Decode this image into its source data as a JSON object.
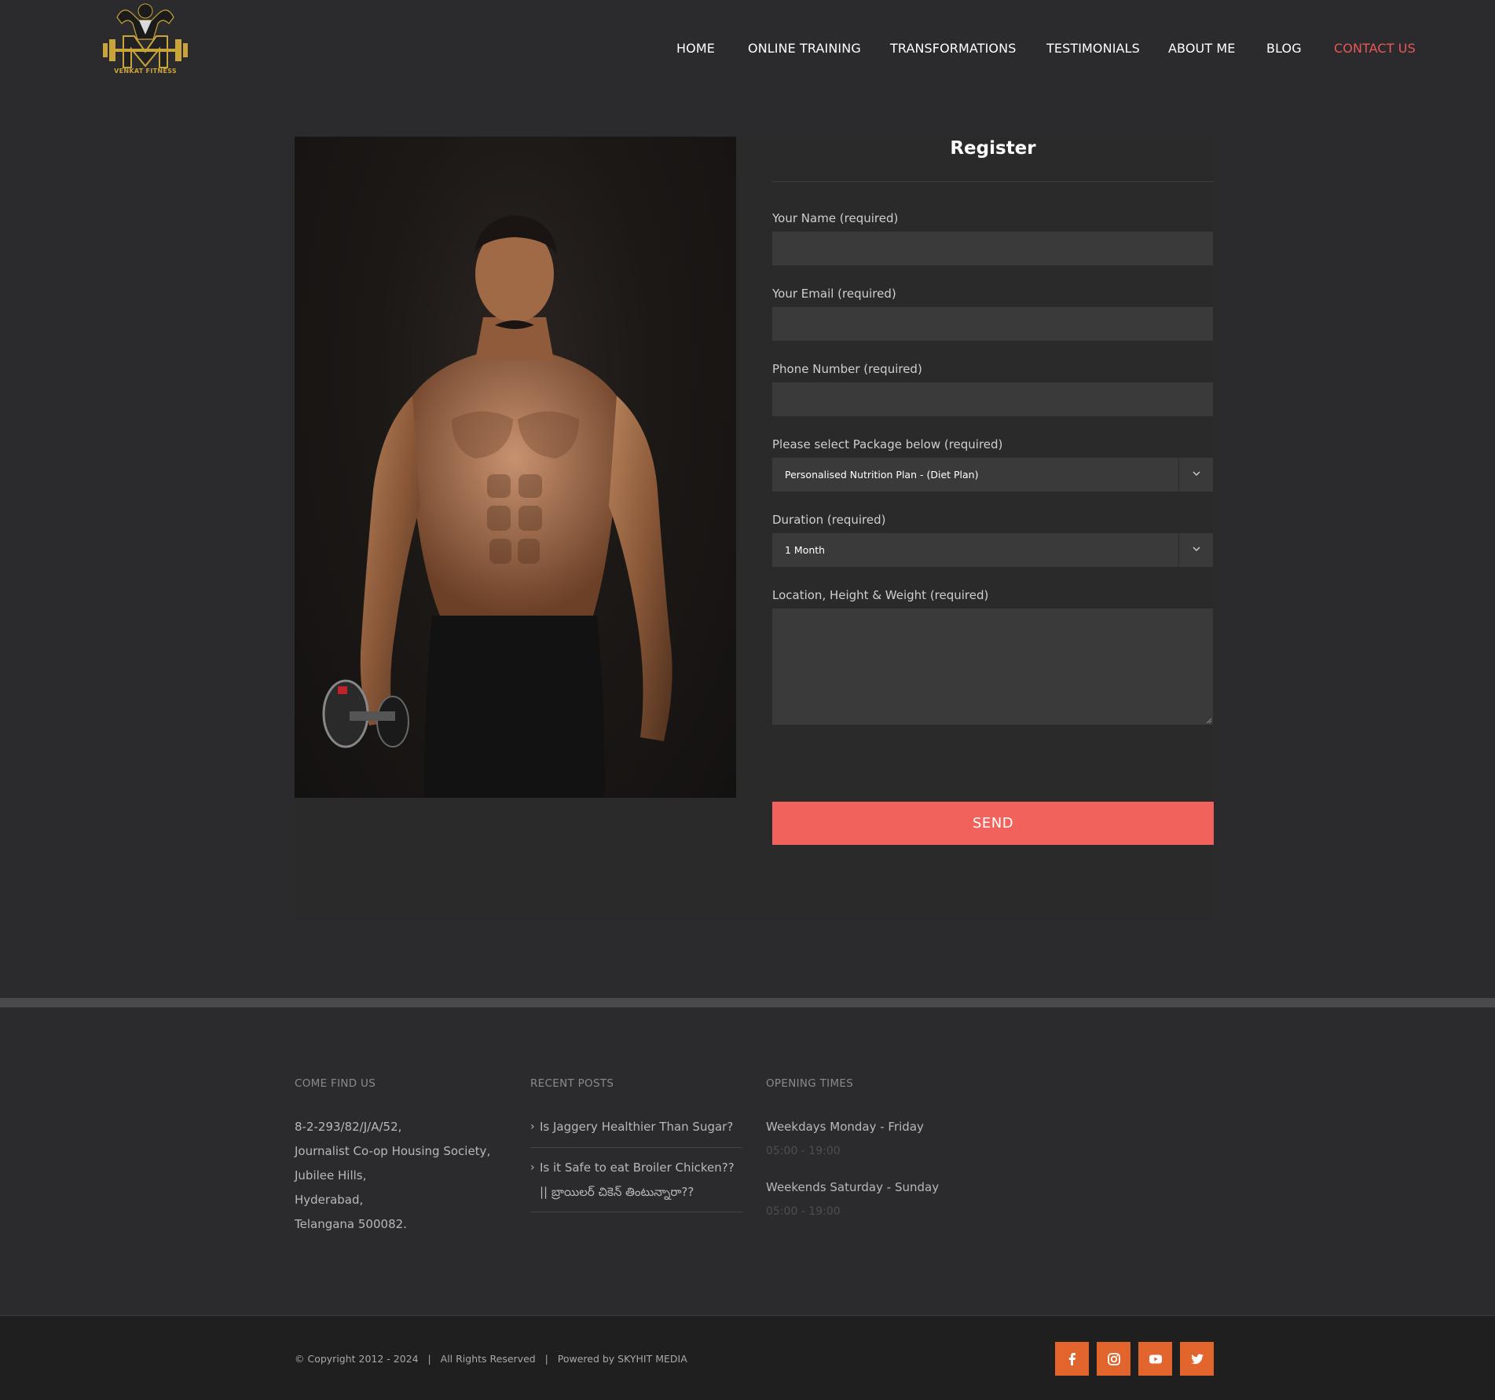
{
  "nav": {
    "items": [
      {
        "label": "HOME"
      },
      {
        "label": "ONLINE TRAINING"
      },
      {
        "label": "TRANSFORMATIONS"
      },
      {
        "label": "TESTIMONIALS"
      },
      {
        "label": "ABOUT ME"
      },
      {
        "label": "BLOG"
      },
      {
        "label": "CONTACT US",
        "active": true
      }
    ]
  },
  "logo": {
    "text": "VENKAT FITNESS"
  },
  "form": {
    "title": "Register",
    "fields": [
      {
        "label": "Your Name (required)",
        "value": ""
      },
      {
        "label": "Your Email (required)",
        "value": ""
      },
      {
        "label": "Phone Number (required)",
        "value": ""
      },
      {
        "label": "Please select Package below (required)",
        "value": "Personalised Nutrition Plan - (Diet Plan)"
      },
      {
        "label": "Duration (required)",
        "value": "1 Month"
      },
      {
        "label": "Location, Height & Weight (required)",
        "value": ""
      }
    ],
    "submit_label": "SEND"
  },
  "footer": {
    "find_us": {
      "title": "COME FIND US",
      "lines": [
        "8-2-293/82/J/A/52,",
        "Journalist Co-op Housing Society,",
        "Jubilee Hills,",
        "Hyderabad,",
        "Telangana 500082."
      ]
    },
    "recent_posts": {
      "title": "RECENT POSTS",
      "posts": [
        {
          "title": "Is Jaggery Healthier Than Sugar?"
        },
        {
          "title": "Is it Safe to eat Broiler Chicken?? || బ్రాయిలర్ చికెన్ తింటున్నారా??"
        }
      ]
    },
    "opening_times": {
      "title": "OPENING TIMES",
      "rows": [
        {
          "days": "Weekdays Monday - Friday",
          "hours": "05:00 - 19:00"
        },
        {
          "days": "Weekends Saturday - Sunday",
          "hours": "05:00 - 19:00"
        }
      ]
    }
  },
  "bottom": {
    "copyright": "© Copyright 2012 - 2024   |   All Rights Reserved   |   Powered by SKYHIT MEDIA",
    "social": [
      "facebook-icon",
      "instagram-icon",
      "youtube-icon",
      "twitter-icon"
    ]
  },
  "colors": {
    "accent": "#f0625b",
    "active_nav": "#e85858",
    "social_bg": "#e3652e",
    "background": "#2b2b2d"
  }
}
